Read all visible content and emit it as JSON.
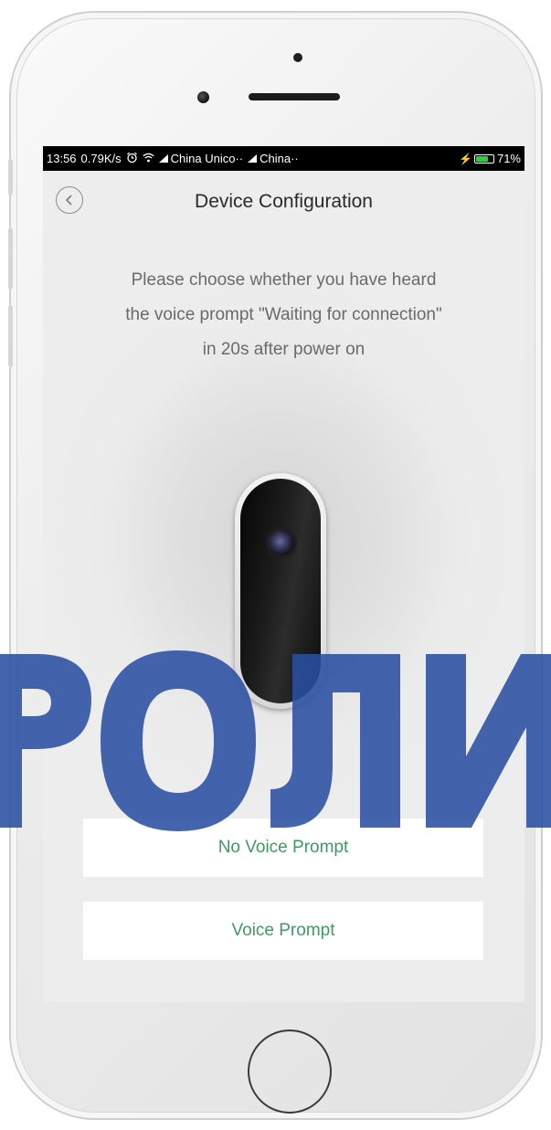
{
  "status_bar": {
    "time": "13:56",
    "net_speed": "0.79K/s",
    "carrier_1": "China Unico··",
    "carrier_2": "China··",
    "battery_percent": "71%",
    "battery_level": 0.71,
    "icons": [
      "alarm-icon",
      "wifi-icon",
      "signal-icon",
      "signal-icon",
      "charging-icon",
      "battery-icon"
    ]
  },
  "nav": {
    "title": "Device Configuration",
    "back_icon": "chevron-left-icon"
  },
  "prompt": {
    "line1": "Please choose whether you have heard",
    "line2": "the voice prompt \"Waiting for connection\"",
    "line3": "in 20s after power on"
  },
  "buttons": {
    "no_voice_prompt": "No Voice Prompt",
    "voice_prompt": "Voice Prompt"
  },
  "colors": {
    "accent_green": "#3f9a63",
    "watermark_blue": "#2b4fa3",
    "status_bar_bg": "#000000",
    "battery_green": "#27d33b"
  },
  "watermark": {
    "text": "РОЛИ"
  }
}
